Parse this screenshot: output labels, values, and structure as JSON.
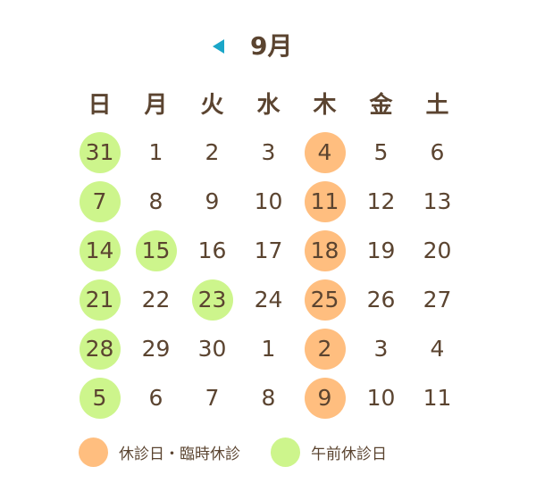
{
  "header": {
    "month_label": "9月",
    "prev_icon": "triangle-left-icon",
    "accent_color": "#1aa6c8"
  },
  "weekdays": [
    "日",
    "月",
    "火",
    "水",
    "木",
    "金",
    "土"
  ],
  "days": [
    {
      "label": "31",
      "status": "morning"
    },
    {
      "label": "1",
      "status": ""
    },
    {
      "label": "2",
      "status": ""
    },
    {
      "label": "3",
      "status": ""
    },
    {
      "label": "4",
      "status": "closed"
    },
    {
      "label": "5",
      "status": ""
    },
    {
      "label": "6",
      "status": ""
    },
    {
      "label": "7",
      "status": "morning"
    },
    {
      "label": "8",
      "status": ""
    },
    {
      "label": "9",
      "status": ""
    },
    {
      "label": "10",
      "status": ""
    },
    {
      "label": "11",
      "status": "closed"
    },
    {
      "label": "12",
      "status": ""
    },
    {
      "label": "13",
      "status": ""
    },
    {
      "label": "14",
      "status": "morning"
    },
    {
      "label": "15",
      "status": "morning"
    },
    {
      "label": "16",
      "status": ""
    },
    {
      "label": "17",
      "status": ""
    },
    {
      "label": "18",
      "status": "closed"
    },
    {
      "label": "19",
      "status": ""
    },
    {
      "label": "20",
      "status": ""
    },
    {
      "label": "21",
      "status": "morning"
    },
    {
      "label": "22",
      "status": ""
    },
    {
      "label": "23",
      "status": "morning"
    },
    {
      "label": "24",
      "status": ""
    },
    {
      "label": "25",
      "status": "closed"
    },
    {
      "label": "26",
      "status": ""
    },
    {
      "label": "27",
      "status": ""
    },
    {
      "label": "28",
      "status": "morning"
    },
    {
      "label": "29",
      "status": ""
    },
    {
      "label": "30",
      "status": ""
    },
    {
      "label": "1",
      "status": ""
    },
    {
      "label": "2",
      "status": "closed"
    },
    {
      "label": "3",
      "status": ""
    },
    {
      "label": "4",
      "status": ""
    },
    {
      "label": "5",
      "status": "morning"
    },
    {
      "label": "6",
      "status": ""
    },
    {
      "label": "7",
      "status": ""
    },
    {
      "label": "8",
      "status": ""
    },
    {
      "label": "9",
      "status": "closed"
    },
    {
      "label": "10",
      "status": ""
    },
    {
      "label": "11",
      "status": ""
    }
  ],
  "legend": {
    "closed_label": "休診日・臨時休診",
    "morning_label": "午前休診日",
    "closed_color": "#ffbe7f",
    "morning_color": "#cdf58c"
  }
}
